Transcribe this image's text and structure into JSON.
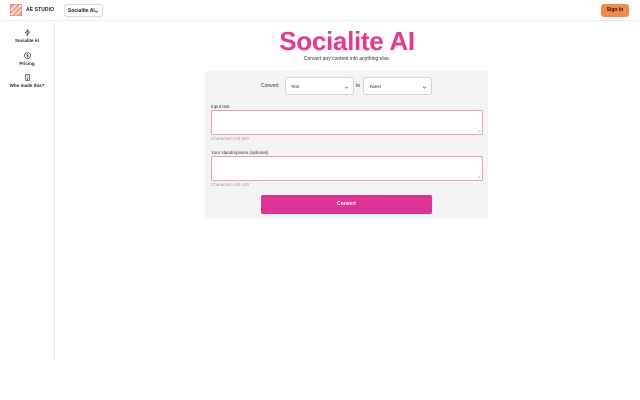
{
  "header": {
    "brand": "AE STUDIO",
    "app_selector": "Socialite AI",
    "sign_in": "Sign In"
  },
  "sidebar": {
    "items": [
      {
        "label": "Socialite AI",
        "icon": "lightning-icon"
      },
      {
        "label": "Pricing",
        "icon": "dollar-icon"
      },
      {
        "label": "Who made this?",
        "icon": "building-icon"
      }
    ]
  },
  "main": {
    "title": "Socialite AI",
    "subtitle": "Convert any content into anything else.",
    "convert_label": "Convert",
    "from_value": "Text",
    "to_label": "to",
    "to_value": "Tweet",
    "input_label": "Input text",
    "input_hint": "Characters left 500",
    "stand_label": "Your stand/opinion (optional)",
    "stand_hint": "Characters left 100",
    "convert_button": "Convert"
  },
  "colors": {
    "accent_pink": "#e03293",
    "title_pink": "#e8378f",
    "sign_in_orange": "#f4894b"
  }
}
